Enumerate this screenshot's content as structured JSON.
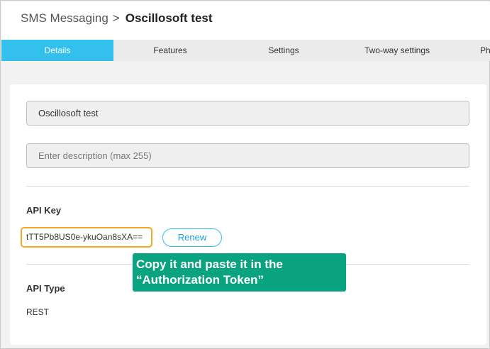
{
  "breadcrumb": {
    "root": "SMS Messaging",
    "separator": ">",
    "current": "Oscillosoft test"
  },
  "tabs": [
    {
      "label": "Details",
      "active": true
    },
    {
      "label": "Features",
      "active": false
    },
    {
      "label": "Settings",
      "active": false
    },
    {
      "label": "Two-way settings",
      "active": false
    },
    {
      "label": "Ph",
      "active": false
    }
  ],
  "form": {
    "name_value": "Oscillosoft test",
    "description_placeholder": "Enter description (max 255)",
    "api_key_label": "API Key",
    "api_key_value": "tTT5Pb8US0e-ykuOan8sXA==",
    "renew_label": "Renew",
    "api_type_label": "API Type",
    "api_type_value": "REST"
  },
  "callout": {
    "line1": "Copy it and paste it in the",
    "line2": "“Authorization Token”"
  },
  "colors": {
    "accent": "#33c0ed",
    "highlight_border": "#f5a623",
    "callout_bg": "#0aa37f"
  }
}
